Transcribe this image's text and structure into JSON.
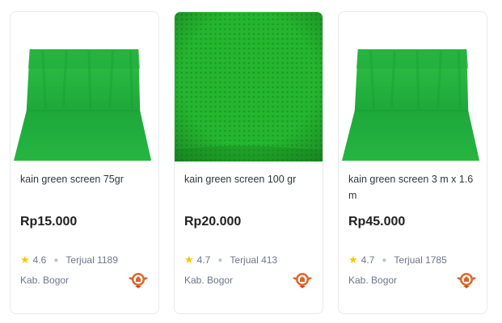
{
  "products": [
    {
      "name": "kain green screen 75gr",
      "price": "Rp15.000",
      "rating": "4.6",
      "sold": "Terjual 1189",
      "location": "Kab. Bogor",
      "image_style": "backdrop"
    },
    {
      "name": "kain green screen 100 gr",
      "price": "Rp20.000",
      "rating": "4.7",
      "sold": "Terjual 413",
      "location": "Kab. Bogor",
      "image_style": "fabric"
    },
    {
      "name": "kain green screen 3 m x 1.6 m",
      "price": "Rp45.000",
      "rating": "4.7",
      "sold": "Terjual 1785",
      "location": "Kab. Bogor",
      "image_style": "backdrop"
    }
  ],
  "colors": {
    "green": "#1fae3a",
    "star": "#ffc400",
    "badge": "#e0632a"
  },
  "icons": {
    "rating": "star-icon",
    "badge": "shop-badge-icon"
  }
}
